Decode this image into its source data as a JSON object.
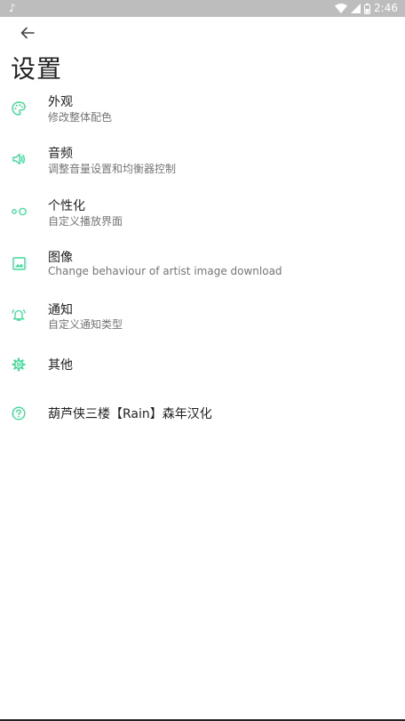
{
  "status_bar": {
    "left_icon": "music-note-icon",
    "time": "2:46",
    "icons": [
      "wifi-icon",
      "signal-icon",
      "battery-icon"
    ]
  },
  "header": {
    "back_icon": "arrow-left-icon",
    "title": "设置"
  },
  "colors": {
    "accent": "#3ddc97",
    "text_primary": "#212121",
    "text_secondary": "#757575",
    "status_bar": "#bdbdbd"
  },
  "settings": [
    {
      "icon": "palette-icon",
      "title": "外观",
      "subtitle": "修改整体配色"
    },
    {
      "icon": "volume-icon",
      "title": "音频",
      "subtitle": "调整音量设置和均衡器控制"
    },
    {
      "icon": "personalize-icon",
      "title": "个性化",
      "subtitle": "自定义播放界面"
    },
    {
      "icon": "image-icon",
      "title": "图像",
      "subtitle": "Change behaviour of artist image download"
    },
    {
      "icon": "bell-icon",
      "title": "通知",
      "subtitle": "自定义通知类型"
    },
    {
      "icon": "gear-icon",
      "title": "其他",
      "subtitle": ""
    },
    {
      "icon": "help-icon",
      "title": "葫芦侠三楼【Rain】森年汉化",
      "subtitle": ""
    }
  ]
}
